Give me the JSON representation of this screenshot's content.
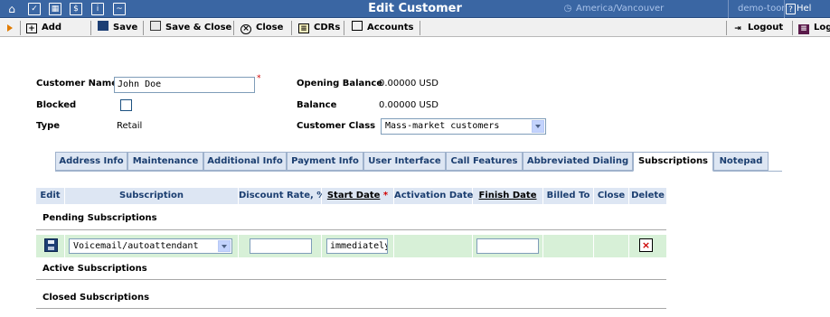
{
  "titlebar": {
    "title": "Edit Customer",
    "timezone": "America/Vancouver",
    "username": "demo-toor",
    "help": "Hel"
  },
  "toolbar": {
    "add": "Add",
    "save": "Save",
    "save_close": "Save & Close",
    "close": "Close",
    "cdrs": "CDRs",
    "accounts": "Accounts",
    "logout": "Logout",
    "log": "Log"
  },
  "form": {
    "customer_name_label": "Customer Name",
    "customer_name_value": "John Doe",
    "blocked_label": "Blocked",
    "blocked_checked": false,
    "type_label": "Type",
    "type_value": "Retail",
    "opening_balance_label": "Opening Balance",
    "opening_balance_value": "0.00000 USD",
    "balance_label": "Balance",
    "balance_value": "0.00000 USD",
    "customer_class_label": "Customer Class",
    "customer_class_value": "Mass-market customers"
  },
  "tabs": [
    "Address Info",
    "Maintenance",
    "Additional Info",
    "Payment Info",
    "User Interface",
    "Call Features",
    "Abbreviated Dialing",
    "Subscriptions",
    "Notepad"
  ],
  "active_tab": "Subscriptions",
  "subscriptions": {
    "columns": {
      "edit": "Edit",
      "subscription": "Subscription",
      "discount_rate": "Discount Rate, %",
      "start_date": "Start Date",
      "activation_date": "Activation Date",
      "finish_date": "Finish Date",
      "billed_to": "Billed To",
      "close": "Close",
      "delete": "Delete"
    },
    "pending_title": "Pending Subscriptions",
    "active_title": "Active Subscriptions",
    "closed_title": "Closed Subscriptions",
    "new_row": {
      "subscription_value": "Voicemail/autoattendant",
      "discount_rate_value": "",
      "start_date_value": "immediately",
      "finish_date_value": ""
    }
  },
  "colors": {
    "titlebar": "#3a66a3",
    "tab_bg": "#dde6f3",
    "row_green": "#d7f0d7",
    "accent_orange": "#e07b00",
    "required_red": "#d00000"
  }
}
